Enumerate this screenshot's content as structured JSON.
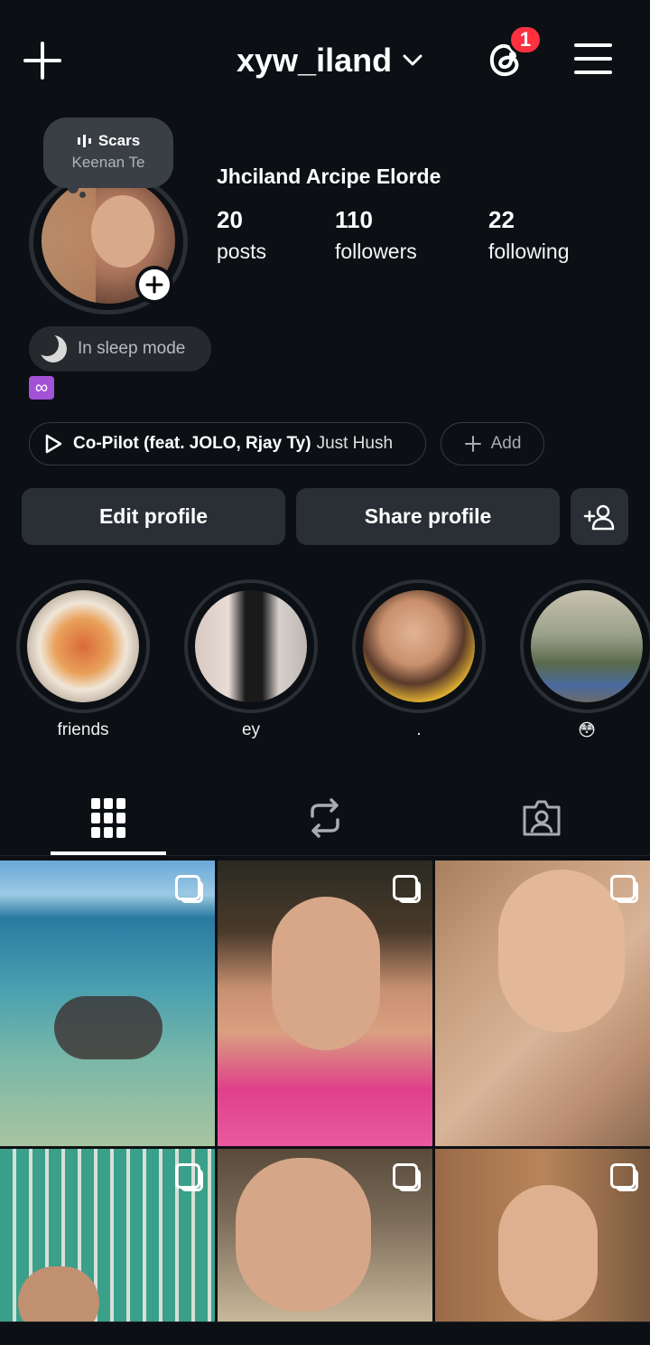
{
  "header": {
    "username": "xyw_iland",
    "threads_badge_count": "1"
  },
  "note": {
    "song": "Scars",
    "artist": "Keenan Te"
  },
  "profile": {
    "display_name": "Jhciland Arcipe Elorde",
    "stats": [
      {
        "value": "20",
        "label": "posts"
      },
      {
        "value": "110",
        "label": "followers"
      },
      {
        "value": "22",
        "label": "following"
      }
    ],
    "status": "In sleep mode",
    "bio_emoji": "♾️",
    "music": {
      "title": "Co-Pilot (feat. JOLO, Rjay Ty)",
      "artist": "Just Hush"
    },
    "add_label": "Add"
  },
  "actions": {
    "edit_profile": "Edit profile",
    "share_profile": "Share profile"
  },
  "highlights": [
    {
      "label": "friends"
    },
    {
      "label": "ey"
    },
    {
      "label": "."
    },
    {
      "label": "😳"
    }
  ],
  "tabs": [
    "posts-grid",
    "reposts",
    "tagged"
  ],
  "colors": {
    "background": "#0c1014",
    "button": "#2a2f35",
    "badge": "#ff3040",
    "infinity": "#a252d6"
  }
}
